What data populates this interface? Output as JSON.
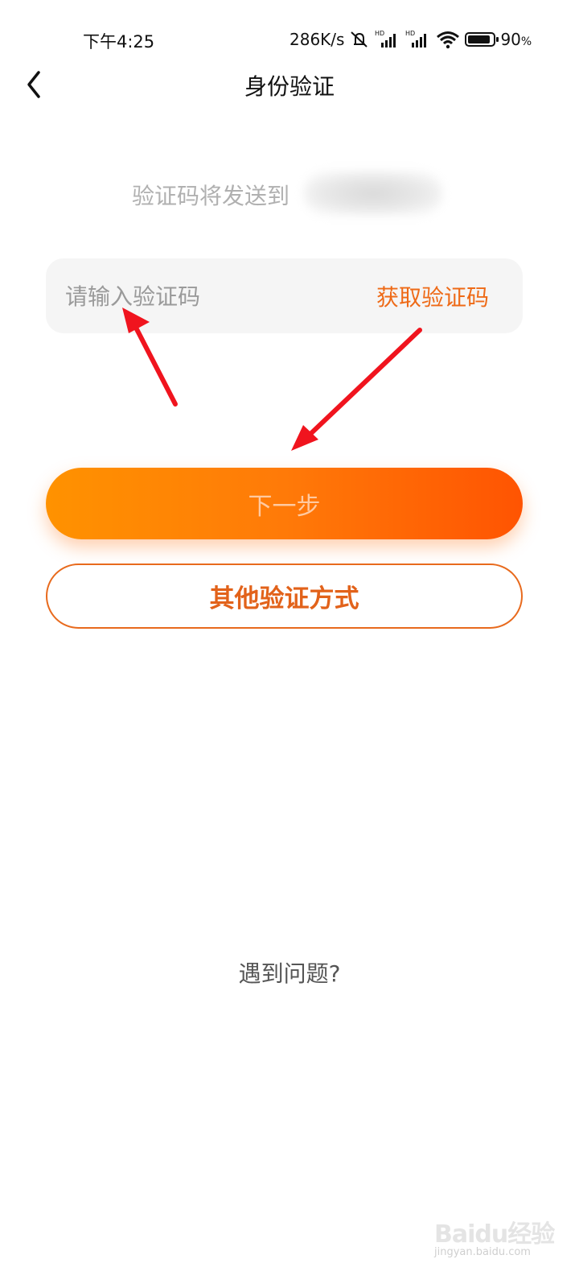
{
  "status_bar": {
    "time": "下午4:25",
    "net_speed": "286K/s",
    "battery_percent": "90",
    "battery_pct_sign": "%",
    "battery_level": 0.9,
    "icons": [
      "mute-icon",
      "hd-signal-icon",
      "hd-signal-icon",
      "wifi-icon",
      "battery-icon"
    ]
  },
  "header": {
    "title": "身份验证",
    "back_icon": "chevron-left-icon"
  },
  "send_info": {
    "text": "验证码将发送到"
  },
  "code_field": {
    "value": "",
    "placeholder": "请输入验证码",
    "get_code_label": "获取验证码"
  },
  "buttons": {
    "next_label": "下一步",
    "other_methods_label": "其他验证方式"
  },
  "help": {
    "label": "遇到问题?"
  },
  "watermark": {
    "main": "Baidu经验",
    "sub": "jingyan.baidu.com"
  },
  "colors": {
    "accent": "#ee6a17",
    "gradient_start": "#ff9200",
    "gradient_end": "#ff5402",
    "annotation_arrow": "#f0141e"
  }
}
